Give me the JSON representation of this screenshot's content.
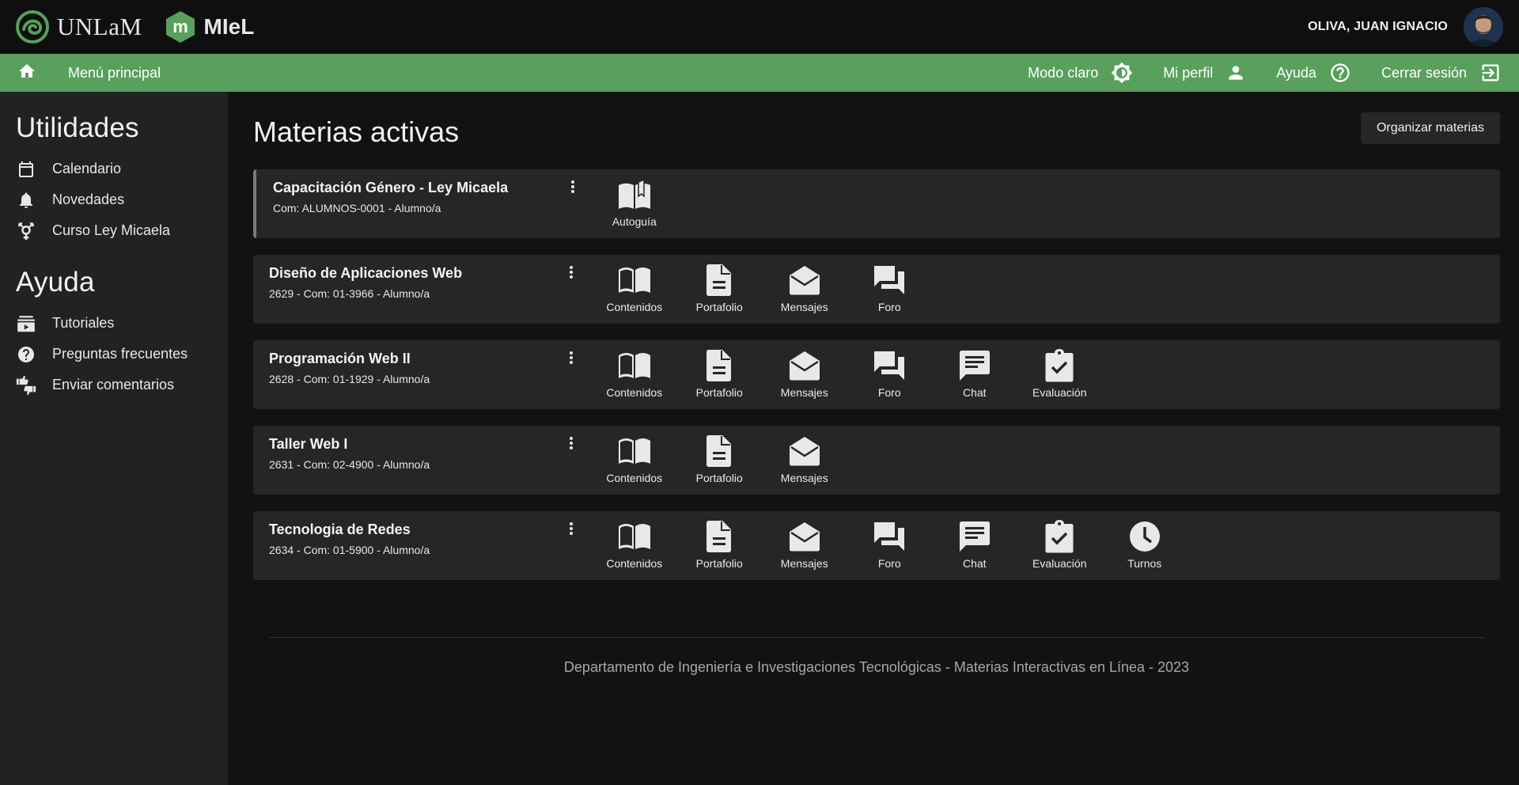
{
  "brand": {
    "unlam_text": "UNLaM",
    "miel_text": "MIeL",
    "miel_mark": "m",
    "accent_color": "#58a05c"
  },
  "user": {
    "name": "OLIVA, JUAN IGNACIO"
  },
  "nav": {
    "home_icon": "home-icon",
    "main_label": "Menú principal",
    "light_mode_label": "Modo claro",
    "profile_label": "Mi perfil",
    "help_label": "Ayuda",
    "logout_label": "Cerrar sesión"
  },
  "sidebar": {
    "utilities_title": "Utilidades",
    "utilities": [
      {
        "label": "Calendario",
        "icon": "calendar-icon"
      },
      {
        "label": "Novedades",
        "icon": "bell-icon"
      },
      {
        "label": "Curso Ley Micaela",
        "icon": "gender-icon"
      }
    ],
    "help_title": "Ayuda",
    "help": [
      {
        "label": "Tutoriales",
        "icon": "video-library-icon"
      },
      {
        "label": "Preguntas frecuentes",
        "icon": "question-icon"
      },
      {
        "label": "Enviar comentarios",
        "icon": "thumbs-icon"
      }
    ]
  },
  "main": {
    "title": "Materias activas",
    "organize_label": "Organizar materias",
    "courses": [
      {
        "name": "Capacitación Género - Ley Micaela",
        "sub": "Com: ALUMNOS-0001 - Alumno/a",
        "tools": [
          {
            "label": "Autoguía",
            "icon": "book-open-icon"
          }
        ]
      },
      {
        "name": "Diseño de Aplicaciones Web",
        "sub": "2629 - Com: 01-3966 - Alumno/a",
        "tools": [
          {
            "label": "Contenidos",
            "icon": "book-icon"
          },
          {
            "label": "Portafolio",
            "icon": "document-icon"
          },
          {
            "label": "Mensajes",
            "icon": "mail-open-icon"
          },
          {
            "label": "Foro",
            "icon": "forum-icon"
          }
        ]
      },
      {
        "name": "Programación Web II",
        "sub": "2628 - Com: 01-1929 - Alumno/a",
        "tools": [
          {
            "label": "Contenidos",
            "icon": "book-icon"
          },
          {
            "label": "Portafolio",
            "icon": "document-icon"
          },
          {
            "label": "Mensajes",
            "icon": "mail-open-icon"
          },
          {
            "label": "Foro",
            "icon": "forum-icon"
          },
          {
            "label": "Chat",
            "icon": "chat-icon"
          },
          {
            "label": "Evaluación",
            "icon": "clipboard-check-icon"
          }
        ]
      },
      {
        "name": "Taller Web I",
        "sub": "2631 - Com: 02-4900 - Alumno/a",
        "tools": [
          {
            "label": "Contenidos",
            "icon": "book-icon"
          },
          {
            "label": "Portafolio",
            "icon": "document-icon"
          },
          {
            "label": "Mensajes",
            "icon": "mail-open-icon"
          }
        ]
      },
      {
        "name": "Tecnologia de Redes",
        "sub": "2634 - Com: 01-5900 - Alumno/a",
        "tools": [
          {
            "label": "Contenidos",
            "icon": "book-icon"
          },
          {
            "label": "Portafolio",
            "icon": "document-icon"
          },
          {
            "label": "Mensajes",
            "icon": "mail-open-icon"
          },
          {
            "label": "Foro",
            "icon": "forum-icon"
          },
          {
            "label": "Chat",
            "icon": "chat-icon"
          },
          {
            "label": "Evaluación",
            "icon": "clipboard-check-icon"
          },
          {
            "label": "Turnos",
            "icon": "clock-icon"
          }
        ]
      }
    ]
  },
  "footer": {
    "text": "Departamento de Ingeniería e Investigaciones Tecnológicas - Materias Interactivas en Línea - 2023"
  }
}
